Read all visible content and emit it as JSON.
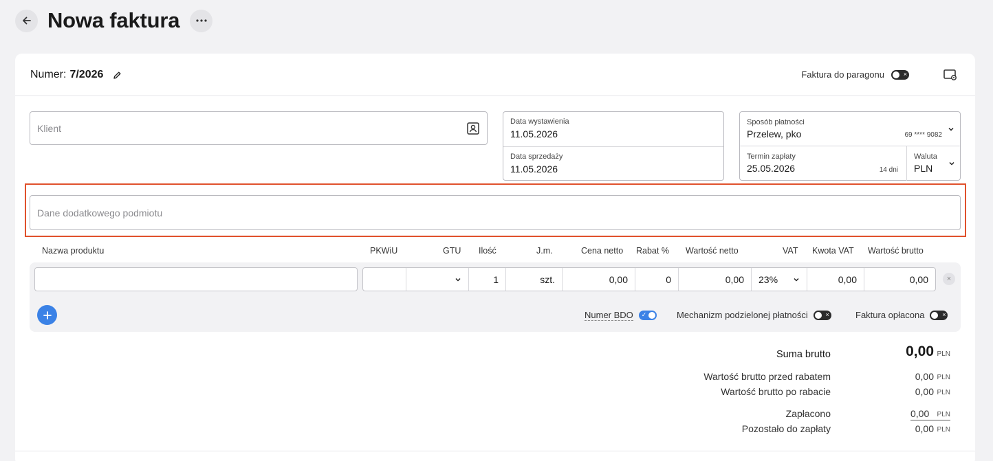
{
  "header": {
    "title": "Nowa faktura"
  },
  "invoice": {
    "number_label": "Numer:",
    "number_value": "7/2026",
    "receipt_toggle_label": "Faktura do paragonu"
  },
  "client": {
    "placeholder": "Klient"
  },
  "dates": {
    "issue_label": "Data wystawienia",
    "issue_value": "11.05.2026",
    "sale_label": "Data sprzedaży",
    "sale_value": "11.05.2026"
  },
  "payment": {
    "method_label": "Sposób płatności",
    "method_value": "Przelew, pko",
    "account": "69 **** 9082",
    "due_label": "Termin zapłaty",
    "due_value": "25.05.2026",
    "due_days": "14 dni",
    "currency_label": "Waluta",
    "currency_value": "PLN"
  },
  "extra_entity": {
    "placeholder": "Dane dodatkowego podmiotu"
  },
  "columns": [
    "Nazwa produktu",
    "PKWiU",
    "GTU",
    "Ilość",
    "J.m.",
    "Cena netto",
    "Rabat %",
    "Wartość netto",
    "VAT",
    "Kwota VAT",
    "Wartość brutto"
  ],
  "item": {
    "name": "",
    "pkwiu": "",
    "gtu": "",
    "qty": "1",
    "unit": "szt.",
    "net_price": "0,00",
    "discount": "0",
    "net_value": "0,00",
    "vat": "23%",
    "vat_amount": "0,00",
    "gross_value": "0,00",
    "remove_glyph": "×"
  },
  "options": {
    "bdo_label": "Numer BDO",
    "bdo_on": true,
    "split_label": "Mechanizm podzielonej płatności",
    "split_on": false,
    "paid_label": "Faktura opłacona",
    "paid_on": false
  },
  "summary": {
    "currency": "PLN",
    "total_label": "Suma brutto",
    "total_value": "0,00",
    "before_discount_label": "Wartość brutto przed rabatem",
    "before_discount_value": "0,00",
    "after_discount_label": "Wartość brutto po rabacie",
    "after_discount_value": "0,00",
    "paid_label": "Zapłacono",
    "paid_value": "0,00",
    "remaining_label": "Pozostało do zapłaty",
    "remaining_value": "0,00"
  },
  "icons": [
    "back-arrow-icon",
    "more-icon",
    "pencil-icon",
    "settings-icon",
    "contact-book-icon",
    "chevron-down-icon",
    "plus-icon",
    "close-icon"
  ],
  "colors": {
    "accent": "#3b82e6",
    "highlight": "#e0512c",
    "background": "#f2f2f4"
  }
}
